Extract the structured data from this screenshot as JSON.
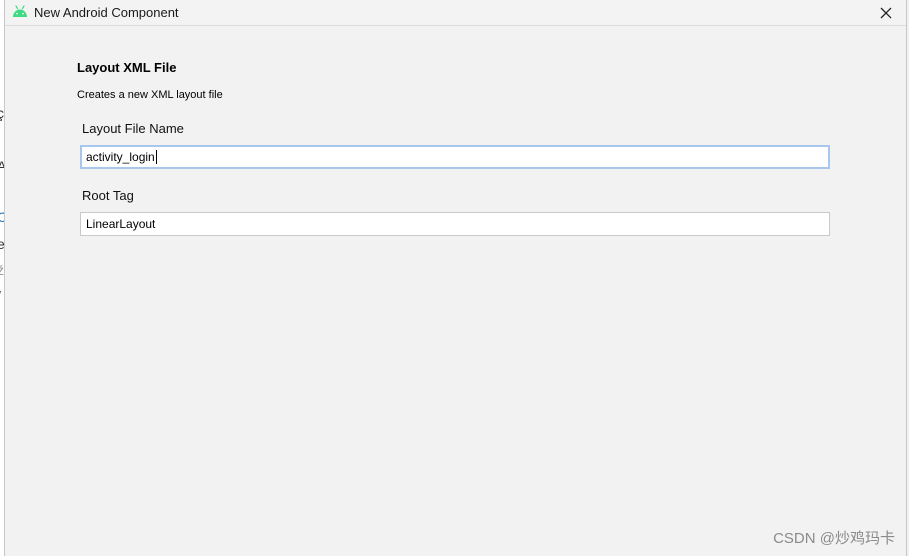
{
  "dialog": {
    "title": "New Android Component",
    "title_icon": "android-icon",
    "close_icon": "close-icon",
    "close_symbol": "✕"
  },
  "form": {
    "heading": "Layout XML File",
    "description": "Creates a new XML layout file",
    "fields": [
      {
        "label": "Layout File Name",
        "value": "activity_login",
        "focused": true
      },
      {
        "label": "Root Tag",
        "value": "LinearLayout",
        "focused": false
      }
    ]
  },
  "background": {
    "chars": [
      "ç",
      "A",
      "C",
      "e",
      "ž",
      "/"
    ]
  },
  "watermark": "CSDN @炒鸡玛卡",
  "colors": {
    "android_green": "#3ddc84",
    "focus_border": "#a7c8ec"
  }
}
